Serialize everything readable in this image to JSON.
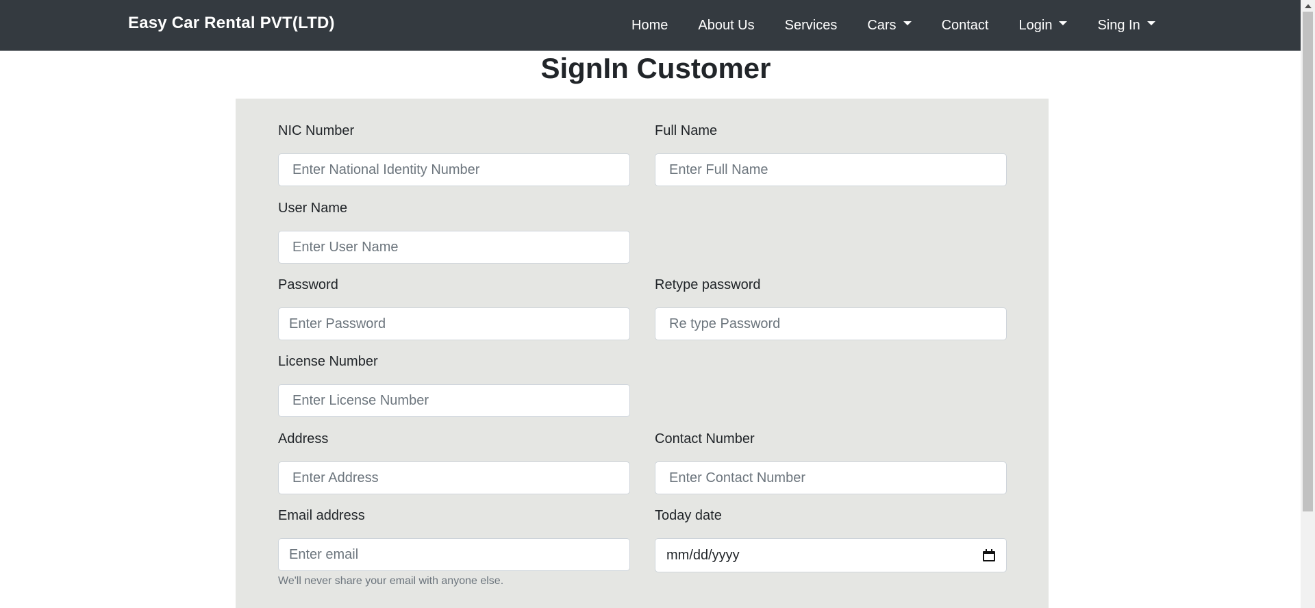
{
  "navbar": {
    "brand": "Easy Car Rental PVT(LTD)",
    "links": [
      "Home",
      "About Us",
      "Services",
      "Cars",
      "Contact",
      "Login",
      "Sing In"
    ]
  },
  "page_title": "SignIn Customer",
  "form": {
    "nic": {
      "label": "NIC Number",
      "placeholder": "Enter National Identity Number"
    },
    "full_name": {
      "label": "Full Name",
      "placeholder": "Enter Full Name"
    },
    "user_name": {
      "label": "User Name",
      "placeholder": "Enter User Name"
    },
    "password": {
      "label": "Password",
      "placeholder": "Enter Password"
    },
    "retype_password": {
      "label": "Retype password",
      "placeholder": "Re type Password"
    },
    "license": {
      "label": "License Number",
      "placeholder": "Enter License Number"
    },
    "address": {
      "label": "Address",
      "placeholder": "Enter Address"
    },
    "contact": {
      "label": "Contact Number",
      "placeholder": "Enter Contact Number"
    },
    "email": {
      "label": "Email address",
      "placeholder": "Enter email",
      "help": "We'll never share your email with anyone else."
    },
    "today_date": {
      "label": "Today date",
      "value": "mm/dd/yyyy"
    }
  },
  "icons": {
    "calendar": "calendar-icon",
    "dropdown": "caret-down-icon"
  },
  "colors": {
    "navbar_bg": "#343a40",
    "form_bg": "#e5e6e3"
  }
}
